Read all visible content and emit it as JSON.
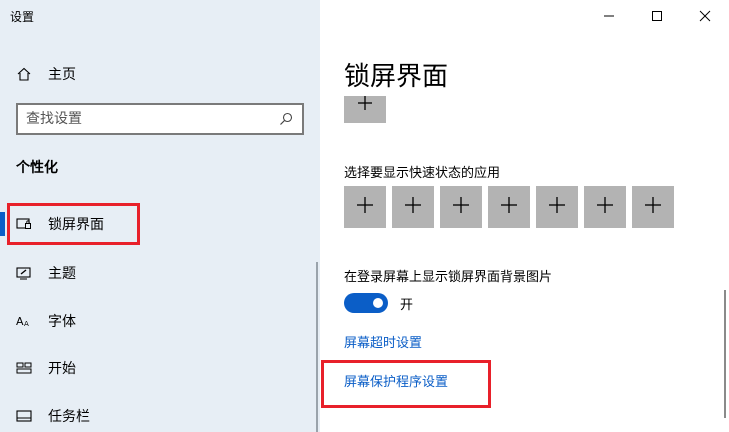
{
  "window": {
    "title": "设置"
  },
  "sidebar": {
    "home_label": "主页",
    "search_placeholder": "查找设置",
    "section_title": "个性化",
    "items": [
      {
        "label": "锁屏界面",
        "icon": "lock-screen-icon",
        "active": true
      },
      {
        "label": "主题",
        "icon": "theme-brush-icon"
      },
      {
        "label": "字体",
        "icon": "font-icon"
      },
      {
        "label": "开始",
        "icon": "start-icon"
      },
      {
        "label": "任务栏",
        "icon": "taskbar-icon"
      }
    ]
  },
  "main": {
    "page_title": "锁屏界面",
    "quick_status_label": "选择要显示快速状态的应用",
    "quick_status_slots": 7,
    "background_label": "在登录屏幕上显示锁屏界面背景图片",
    "toggle_state": "开",
    "toggle_on": true,
    "link_timeout": "屏幕超时设置",
    "link_screensaver": "屏幕保护程序设置"
  },
  "colors": {
    "accent": "#0b5ec7",
    "highlight": "#e8202a",
    "sidebar_bg": "#e7eef5",
    "tile": "#b3b3b3"
  }
}
